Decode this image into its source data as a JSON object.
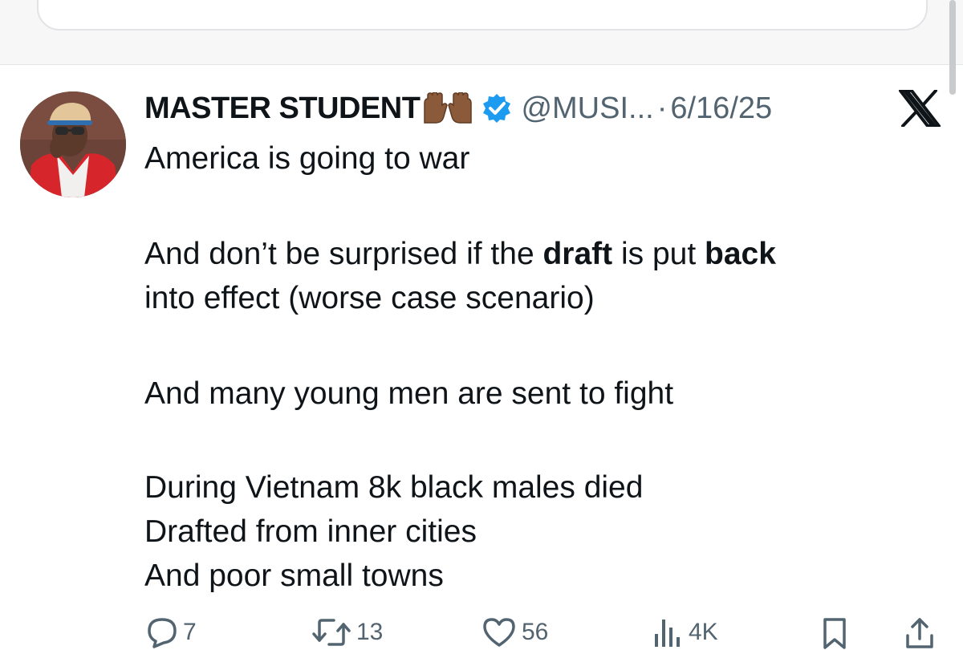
{
  "tweet": {
    "author": {
      "display_name": "MASTER STUDENT",
      "emoji": "raised-hands-emoji",
      "verified": true,
      "handle": "@MUSI...",
      "separator": "·"
    },
    "date": "6/16/25",
    "platform_logo": "x-logo",
    "body": {
      "line1": "America is going to war",
      "p2_part1": "And don’t be surprised if the ",
      "p2_bold1": "draft",
      "p2_part2": " is put ",
      "p2_bold2": "back",
      "p2_line2": "into effect (worse case scenario)",
      "line3": "And many young men are sent to fight",
      "line4": "During Vietnam 8k black males died",
      "line5": "Drafted from inner cities",
      "line6": "And poor small towns"
    },
    "actions": {
      "replies": "7",
      "reposts": "13",
      "likes": "56",
      "views": "4K"
    }
  },
  "colors": {
    "text": "#0f1419",
    "secondary": "#536471",
    "verified_badge": "#1d9bf0",
    "band": "#f7f7f8"
  }
}
